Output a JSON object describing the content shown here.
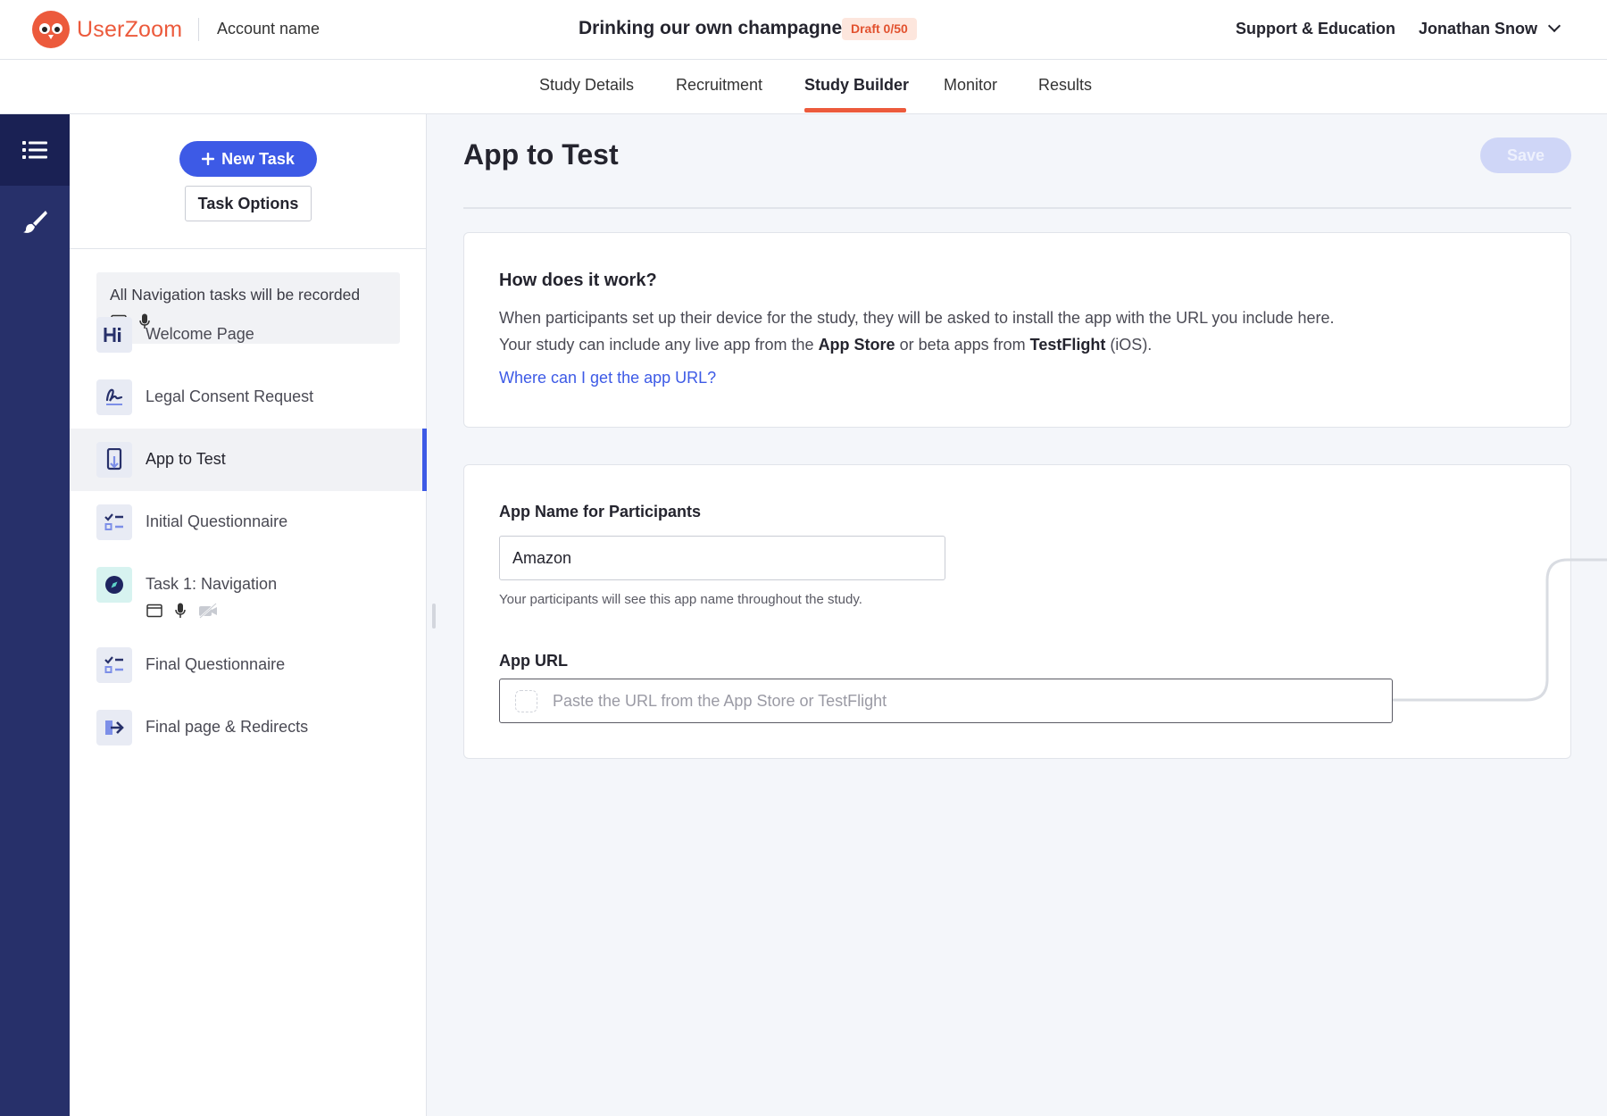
{
  "header": {
    "brand": "UserZoom",
    "account_name": "Account name",
    "study_title": "Drinking our own champagne",
    "draft_badge": "Draft 0/50",
    "support_link": "Support & Education",
    "user_name": "Jonathan Snow"
  },
  "tabs": [
    {
      "label": "Study Details",
      "active": false
    },
    {
      "label": "Recruitment",
      "active": false
    },
    {
      "label": "Study Builder",
      "active": true
    },
    {
      "label": "Monitor",
      "active": false
    },
    {
      "label": "Results",
      "active": false
    }
  ],
  "rail": {
    "items": [
      {
        "icon": "list-icon",
        "active": true
      },
      {
        "icon": "brush-icon",
        "active": false
      }
    ]
  },
  "panel": {
    "new_task_label": "New Task",
    "task_options_label": "Task Options",
    "info_text": "All Navigation tasks will be recorded",
    "tasks": [
      {
        "label": "Welcome Page",
        "icon": "hi-icon",
        "active": false
      },
      {
        "label": "Legal Consent Request",
        "icon": "signature-icon",
        "active": false
      },
      {
        "label": "App to Test",
        "icon": "phone-download-icon",
        "active": true
      },
      {
        "label": "Initial Questionnaire",
        "icon": "checklist-icon",
        "active": false
      },
      {
        "label": "Task 1: Navigation",
        "icon": "compass-icon",
        "active": false,
        "sub_icons": [
          "screen-icon",
          "mic-icon",
          "camera-off-icon"
        ]
      },
      {
        "label": "Final Questionnaire",
        "icon": "checklist-icon",
        "active": false
      },
      {
        "label": "Final page & Redirects",
        "icon": "exit-arrow-icon",
        "active": false
      }
    ]
  },
  "main": {
    "title": "App to Test",
    "save_label": "Save",
    "how": {
      "heading": "How does it work?",
      "line1": "When participants set up their device for the study, they will be asked to install the app with the URL you include here.",
      "line2_prefix": "Your study can include any live app from the ",
      "line2_bold1": "App Store",
      "line2_mid": " or beta apps from ",
      "line2_bold2": "TestFlight",
      "line2_suffix": " (iOS).",
      "link": "Where can I get the app URL?"
    },
    "form": {
      "app_name_label": "App Name for Participants",
      "app_name_value": "Amazon",
      "app_name_helper": "Your participants will see this app name throughout the study.",
      "app_url_label": "App URL",
      "app_url_value": "",
      "app_url_placeholder": "Paste the URL from the App Store or TestFlight"
    }
  },
  "colors": {
    "brand": "#ec5a3c",
    "primary": "#3d5ae6",
    "rail": "#27306a"
  }
}
